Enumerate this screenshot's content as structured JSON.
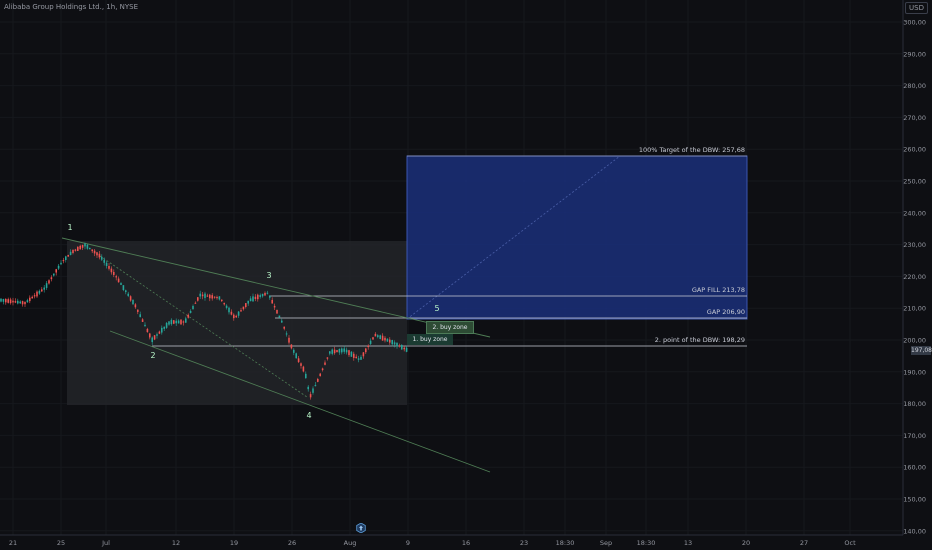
{
  "header": {
    "title": "Alibaba Group Holdings Ltd., 1h, NYSE",
    "currency_badge": "USD"
  },
  "price_axis": {
    "labels": [
      "300,00",
      "290,00",
      "280,00",
      "270,00",
      "260,00",
      "250,00",
      "240,00",
      "230,00",
      "220,00",
      "210,00",
      "200,00",
      "190,00",
      "180,00",
      "170,00",
      "160,00",
      "150,00",
      "140,00"
    ],
    "current_price_label": "197,08"
  },
  "time_axis": {
    "labels": [
      "21",
      "25",
      "Jul",
      "12",
      "19",
      "26",
      "Aug",
      "9",
      "16",
      "23",
      "18:30",
      "Sep",
      "18:30",
      "13",
      "20",
      "27",
      "Oct"
    ]
  },
  "annotations": {
    "target_label": "100% Target of the DBW: 257,68",
    "gap_fill_label": "GAP FILL 213,78",
    "gap_label": "GAP 206,90",
    "dbw_point_label": "2. point of the DBW: 198,29",
    "buy_zone_2": "2. buy zone",
    "buy_zone_1": "1. buy zone",
    "wave_labels": [
      "1",
      "2",
      "3",
      "4",
      "5"
    ]
  },
  "colors": {
    "background": "#0e0f13",
    "target_box": "#1a2f7a",
    "consolidation_box": "#24262b",
    "up_candle": "#26a69a",
    "down_candle": "#ef5350",
    "wave_label": "#b9f6ca",
    "trendline": "#5a8a5a"
  },
  "icons": {
    "scroll_marker": "up-arrow-badge-icon"
  }
}
